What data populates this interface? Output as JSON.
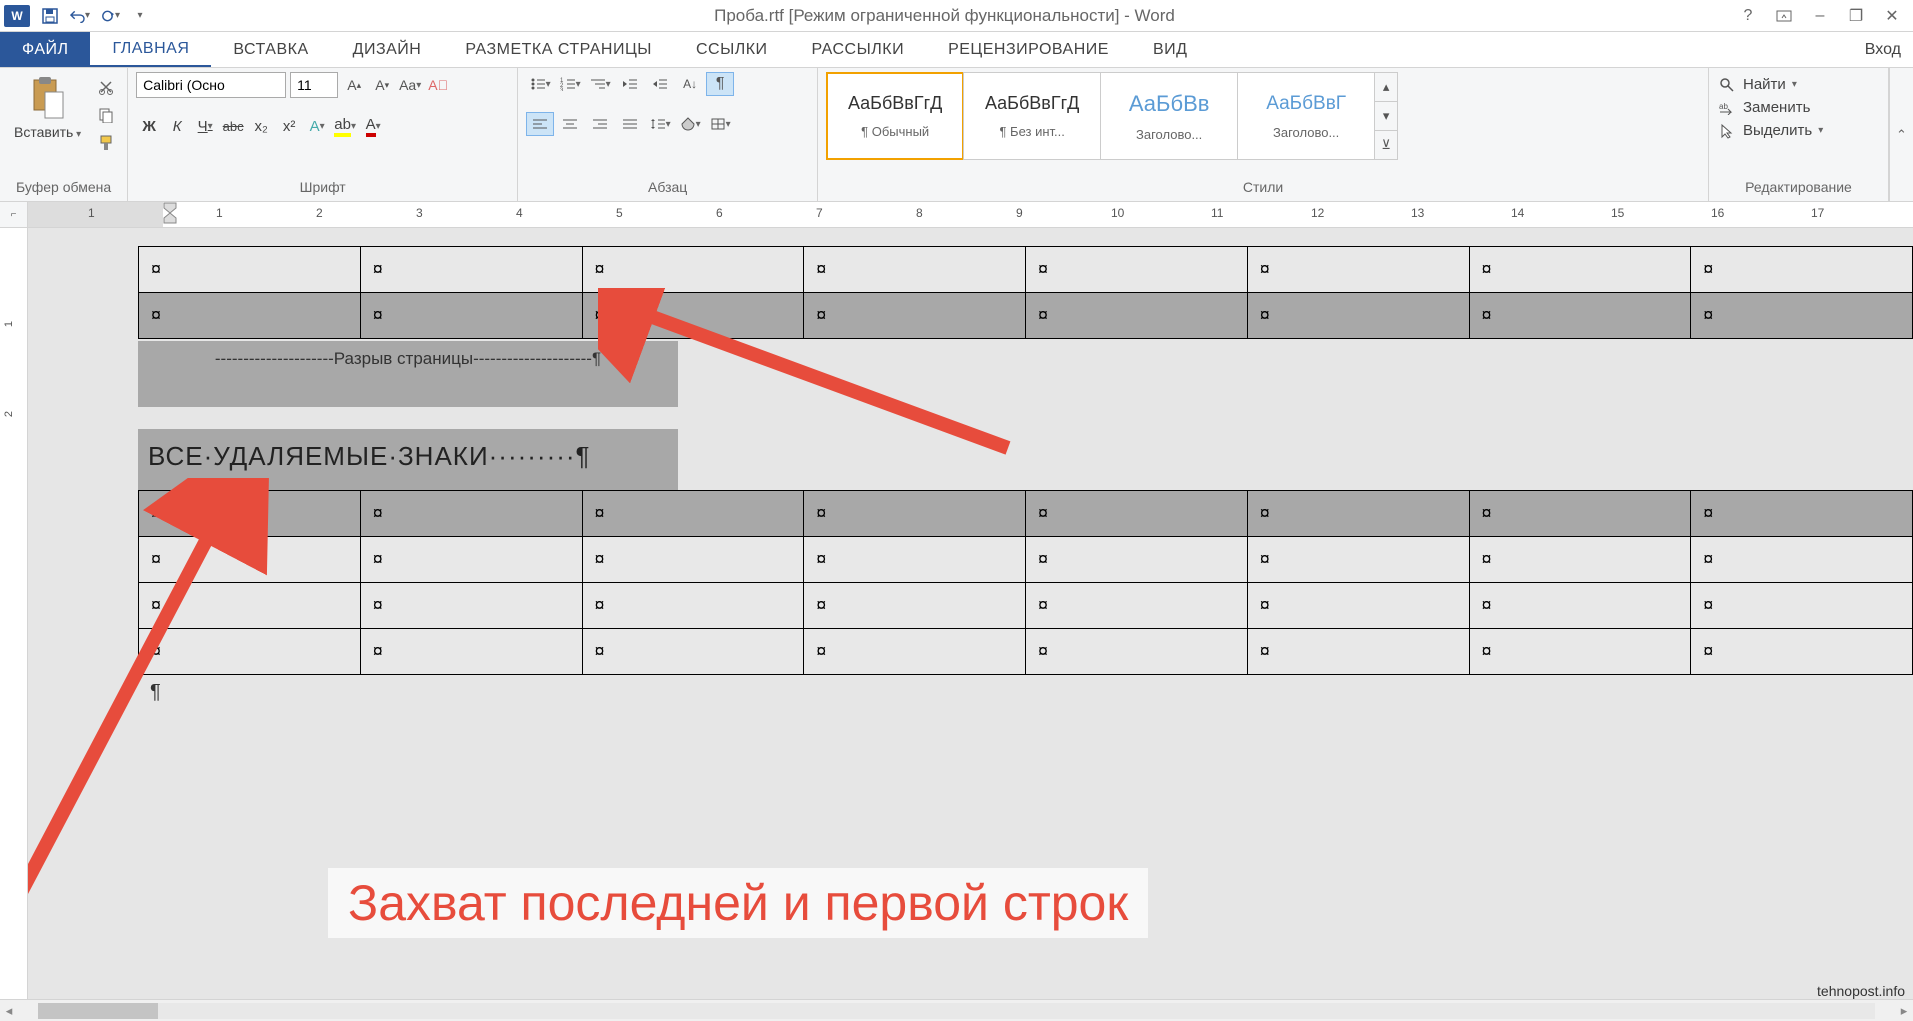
{
  "title": "Проба.rtf [Режим ограниченной функциональности] - Word",
  "qat": {
    "save": "save",
    "undo": "undo",
    "redo": "redo"
  },
  "wincontrols": {
    "help": "?",
    "opts": "ribbon-opts",
    "min": "–",
    "max": "❐",
    "close": "✕"
  },
  "tabs": {
    "file": "ФАЙЛ",
    "items": [
      "ГЛАВНАЯ",
      "ВСТАВКА",
      "ДИЗАЙН",
      "РАЗМЕТКА СТРАНИЦЫ",
      "ССЫЛКИ",
      "РАССЫЛКИ",
      "РЕЦЕНЗИРОВАНИЕ",
      "ВИД"
    ],
    "login": "Вход"
  },
  "ribbon": {
    "clipboard": {
      "paste": "Вставить",
      "label": "Буфер обмена"
    },
    "font": {
      "name": "Calibri (Осно",
      "size": "11",
      "label": "Шрифт",
      "bold": "Ж",
      "italic": "К",
      "underline": "Ч",
      "strike": "abc",
      "sub": "x₂",
      "sup": "x²"
    },
    "paragraph": {
      "label": "Абзац"
    },
    "styles": {
      "label": "Стили",
      "items": [
        {
          "preview": "АаБбВвГгД",
          "name": "¶ Обычный"
        },
        {
          "preview": "АаБбВвГгД",
          "name": "¶ Без инт..."
        },
        {
          "preview": "АаБбВв",
          "name": "Заголово..."
        },
        {
          "preview": "АаБбВвГ",
          "name": "Заголово..."
        }
      ]
    },
    "editing": {
      "label": "Редактирование",
      "find": "Найти",
      "replace": "Заменить",
      "select": "Выделить"
    }
  },
  "ruler": {
    "marks": [
      "1",
      "1",
      "2",
      "3",
      "4",
      "5",
      "6",
      "7",
      "8",
      "9",
      "10",
      "11",
      "12",
      "13",
      "14",
      "15",
      "16",
      "17"
    ]
  },
  "document": {
    "cellmark": "¤",
    "pagebreak": "Разрыв страницы",
    "heading": "ВСЕ·УДАЛЯЕМЫЕ·ЗНАКИ·········¶",
    "pilcrow": "¶"
  },
  "annotation": "Захват последней и первой строк",
  "watermark": "tehnopost.info"
}
